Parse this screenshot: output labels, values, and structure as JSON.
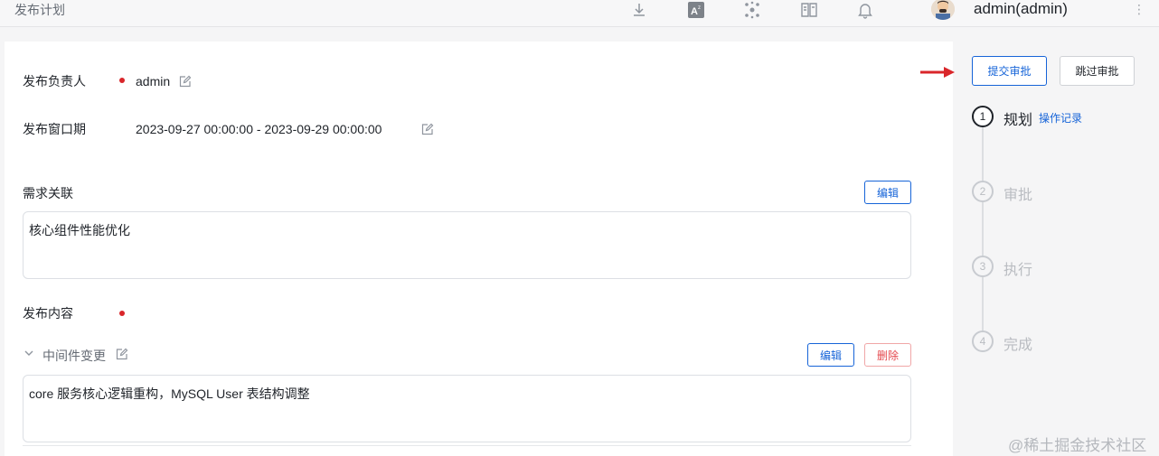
{
  "header": {
    "title": "发布计划",
    "icons": [
      "download-icon",
      "translate-icon",
      "cluster-icon",
      "book-icon",
      "bell-icon"
    ],
    "user": "admin(admin)"
  },
  "form": {
    "owner_label": "发布负责人",
    "owner_value": "admin",
    "window_label": "发布窗口期",
    "window_value": "2023-09-27 00:00:00 - 2023-09-29 00:00:00",
    "requirement_label": "需求关联",
    "requirement_edit": "编辑",
    "requirement_text": "核心组件性能优化",
    "content_label": "发布内容",
    "middleware_title": "中间件变更",
    "middleware_edit": "编辑",
    "middleware_delete": "删除",
    "middleware_text": "core 服务核心逻辑重构，MySQL User 表结构调整"
  },
  "sidebar": {
    "submit_button": "提交审批",
    "skip_button": "跳过审批",
    "op_log_link": "操作记录",
    "steps": [
      {
        "num": "1",
        "label": "规划",
        "active": true
      },
      {
        "num": "2",
        "label": "审批",
        "active": false
      },
      {
        "num": "3",
        "label": "执行",
        "active": false
      },
      {
        "num": "4",
        "label": "完成",
        "active": false
      }
    ]
  },
  "colors": {
    "accent": "#1664d8",
    "required": "#d9262a",
    "danger": "#e5484d",
    "arrow": "#d9262a"
  },
  "watermark": "@稀土掘金技术社区"
}
